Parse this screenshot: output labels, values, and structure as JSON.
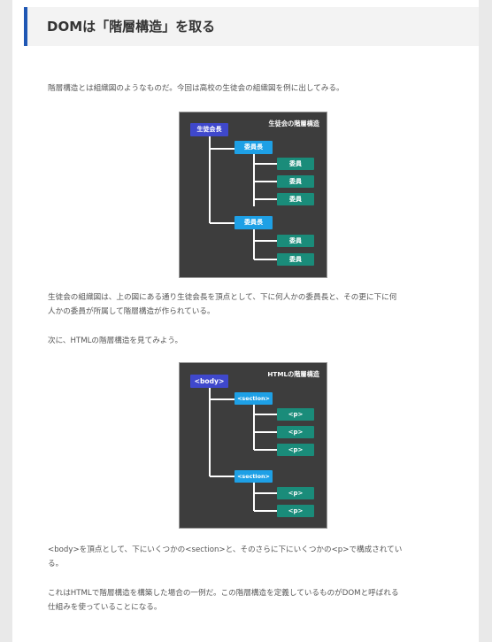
{
  "heading": "DOMは「階層構造」を取る",
  "paragraphs": {
    "p1": "階層構造とは組織図のようなものだ。今回は高校の生徒会の組織図を例に出してみる。",
    "p2_line1": "生徒会の組織図は、上の図にある通り生徒会長を頂点として、下に何人かの委員長と、その更に下に何",
    "p2_line2": "人かの委員が所属して階層構造が作られている。",
    "p3": "次に、HTMLの階層構造を見てみよう。",
    "p4": "<body>を頂点として、下にいくつかの<section>と、そのさらに下にいくつかの<p>で構成されてい",
    "p4_line2": "る。",
    "p5_line1": "これはHTMLで階層構造を構築した場合の一例だ。この階層構造を定義しているものがDOMと呼ばれる",
    "p5_line2": "仕組みを使っていることになる。"
  },
  "diagram1": {
    "title": "生徒会の階層構造",
    "root": "生徒会長",
    "mid1": "委員長",
    "mid2": "委員長",
    "leaf": "委員"
  },
  "diagram2": {
    "title": "HTMLの階層構造",
    "root": "<body>",
    "mid1": "<section>",
    "mid2": "<section>",
    "leaf": "<p>"
  },
  "colors": {
    "accent": "#1f57b4",
    "root": "#3f48cc",
    "mid": "#1ea0e6",
    "leaf": "#1a8c7a",
    "diagram_bg": "#3d3d3d"
  }
}
